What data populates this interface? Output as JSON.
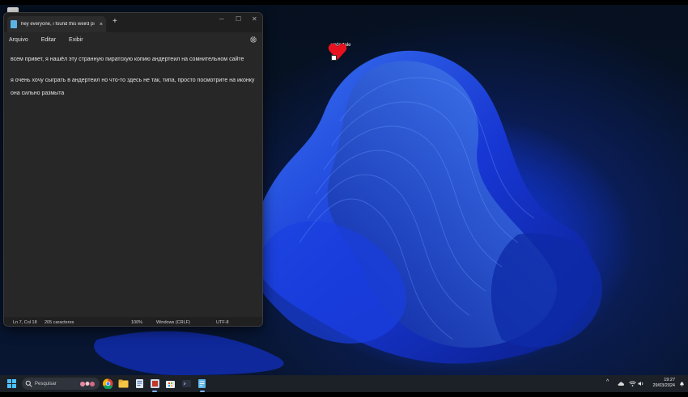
{
  "desktop": {
    "shortcut_label": "undertale"
  },
  "notepad": {
    "tab_title": "hey everyone, i found this weird pi",
    "tab_close": "×",
    "new_tab": "+",
    "controls": {
      "minimize": "─",
      "maximize": "☐",
      "close": "✕"
    },
    "menu": [
      "Arquivo",
      "Editar",
      "Exibir"
    ],
    "lines": [
      "всем привет, я нашёл эту странную пиратскую копию андертеил на сомнительном сайте",
      "я очень хочу сыграть в андертеил но что-то здесь не так, типа, просто посмотрите на иконку",
      "она сильно размыта"
    ],
    "status": {
      "position": "Ln 7, Col 18",
      "chars": "205 caracteres",
      "zoom": "100%",
      "eol": "Windows (CRLF)",
      "encoding": "UTF-8"
    }
  },
  "taskbar": {
    "search_placeholder": "Pesquisar",
    "tray_chevron": "^",
    "time": "19:27",
    "date": "29/03/2024",
    "apps": [
      "chrome-icon",
      "file-explorer-icon",
      "notepad-alt-icon",
      "active-app-icon",
      "store-icon",
      "terminal-icon",
      "notepad-icon"
    ]
  },
  "colors": {
    "accent": "#2b5ee8",
    "window_bg": "#272727",
    "taskbar_bg": "#1c2027"
  }
}
